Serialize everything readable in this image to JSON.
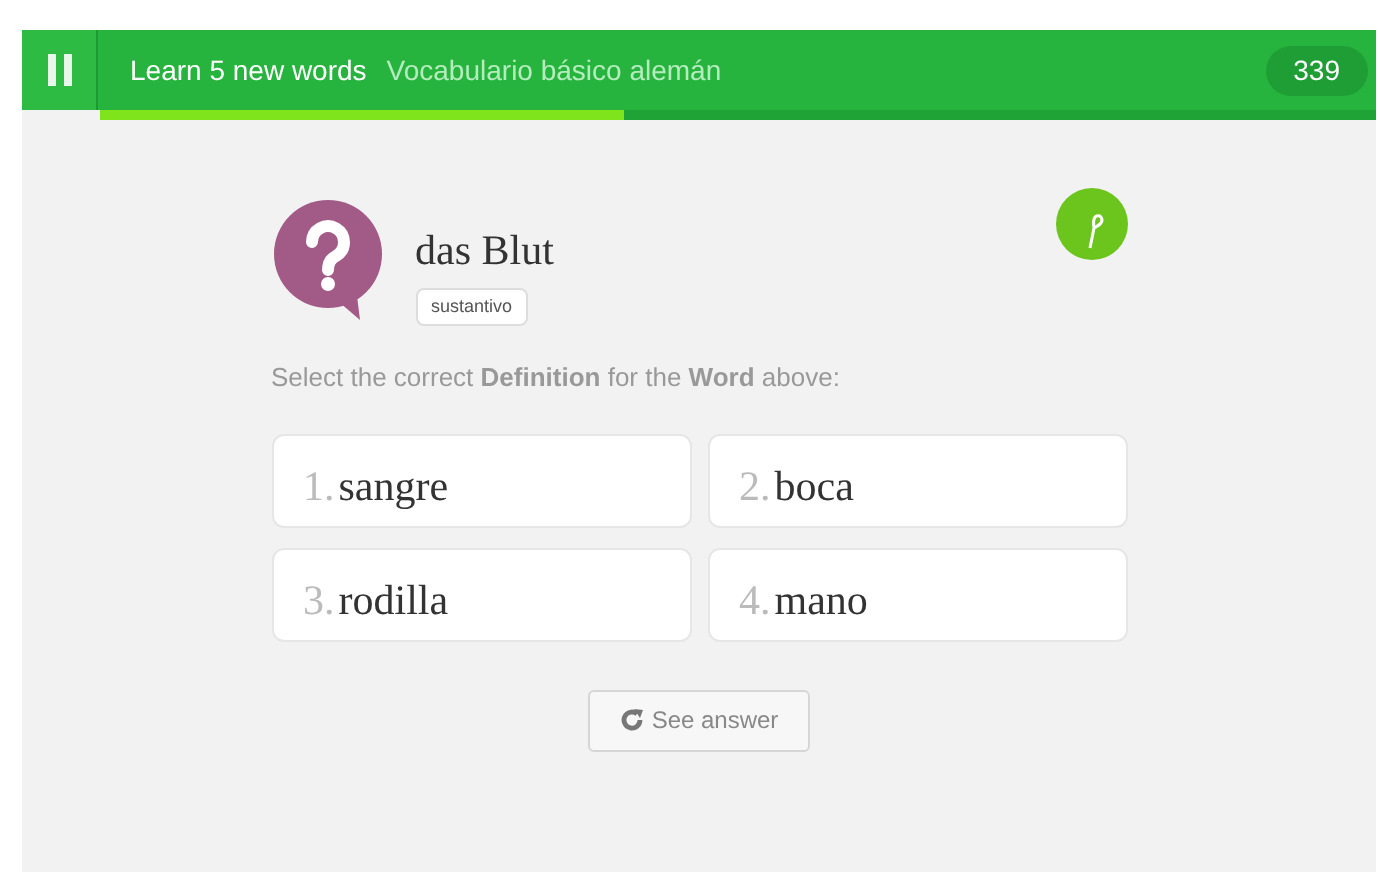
{
  "header": {
    "title": "Learn 5 new words",
    "course": "Vocabulario básico alemán",
    "score": "339",
    "progress": {
      "level": 0.41
    }
  },
  "word": {
    "text": "das Blut",
    "part_of_speech": "sustantivo"
  },
  "instruction": "Select the correct **Definition** for the **Word** above:",
  "options": [
    {
      "number": "1.",
      "text": "sangre"
    },
    {
      "number": "2.",
      "text": "boca"
    },
    {
      "number": "3.",
      "text": "rodilla"
    },
    {
      "number": "4.",
      "text": "mano"
    }
  ],
  "see_answer": "See answer"
}
